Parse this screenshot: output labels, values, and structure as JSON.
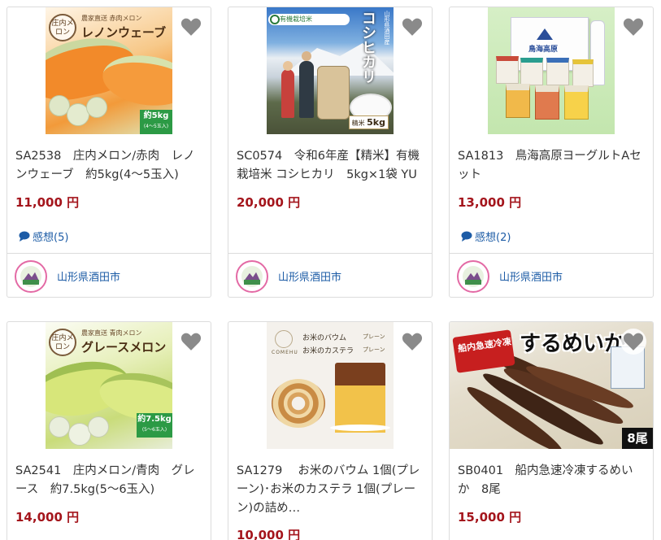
{
  "products": [
    {
      "code_title": "SA2538　庄内メロン/赤肉　レノンウェーブ　約5kg(4～5玉入)",
      "price": "11,000 円",
      "review": "感想(5)",
      "municipality": "山形県酒田市",
      "image_text": {
        "brand": "庄内メロン",
        "small": "農家直送 赤肉メロン",
        "name": "レノンウェーブ",
        "weight": "約5kg",
        "count": "(4～5玉入)"
      }
    },
    {
      "code_title": "SC0574　令和6年産【精米】有機栽培米 コシヒカリ　5kg×1袋 YU",
      "price": "20,000 円",
      "municipality": "山形県酒田市",
      "image_text": {
        "badge": "有機栽培米",
        "region": "山形県酒田産",
        "name": "コシヒカリ",
        "tag": "精米",
        "weight": "5kg"
      }
    },
    {
      "code_title": "SA1813　鳥海高原ヨーグルトAセット",
      "price": "13,000 円",
      "review": "感想(2)",
      "municipality": "山形県酒田市",
      "image_text": {
        "box": "鳥海高原"
      }
    },
    {
      "code_title": "SA2541　庄内メロン/青肉　グレース　約7.5kg(5～6玉入)",
      "price": "14,000 円",
      "image_text": {
        "brand": "庄内メロン",
        "small": "農家直送 青肉メロン",
        "name": "グレースメロン",
        "weight": "約7.5kg",
        "count": "(5～6玉入)"
      }
    },
    {
      "code_title": "SA1279　 お米のバウム 1個(プレーン)･お米のカステラ 1個(プレーン)の詰め…",
      "price": "10,000 円",
      "image_text": {
        "brand": "COMEHU",
        "line1": "お米のバウム",
        "line2": "お米のカステラ",
        "tag1": "プレーン",
        "tag2": "プレーン"
      }
    },
    {
      "code_title": "SB0401　船内急速冷凍するめいか　8尾",
      "price": "15,000 円",
      "image_text": {
        "tag": "船内急速冷凍",
        "name": "するめいか",
        "count": "8尾"
      }
    }
  ],
  "colors": {
    "price": "#a4151c",
    "link": "#1d5ca6",
    "border": "#dcdcdc",
    "heart": "#8a8a8a"
  }
}
